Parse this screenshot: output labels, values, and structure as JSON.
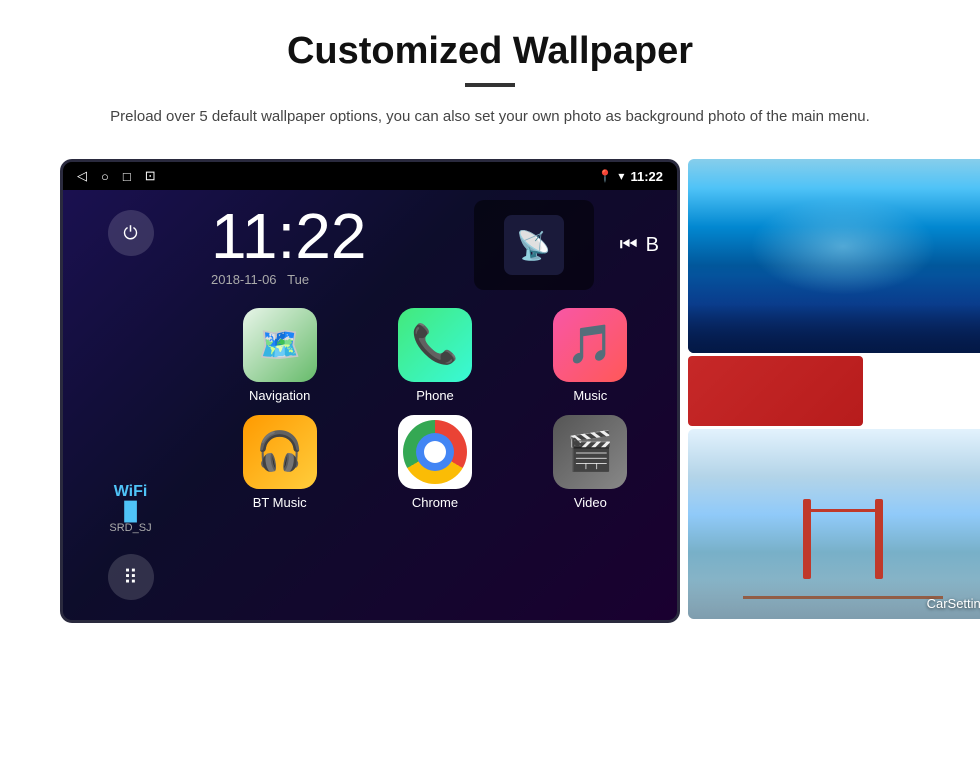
{
  "page": {
    "title": "Customized Wallpaper",
    "divider": "—",
    "subtitle": "Preload over 5 default wallpaper options, you can also set your own photo as background photo of the main menu."
  },
  "device": {
    "statusBar": {
      "time": "11:22",
      "icons": [
        "back",
        "home",
        "recent",
        "screenshot"
      ],
      "rightIcons": [
        "location",
        "wifi",
        "signal"
      ]
    },
    "clock": {
      "time": "11:22",
      "date": "2018-11-06",
      "day": "Tue"
    },
    "wifi": {
      "label": "WiFi",
      "ssid": "SRD_SJ"
    },
    "apps": [
      {
        "name": "Navigation",
        "icon": "nav"
      },
      {
        "name": "Phone",
        "icon": "phone"
      },
      {
        "name": "Music",
        "icon": "music"
      },
      {
        "name": "BT Music",
        "icon": "bt"
      },
      {
        "name": "Chrome",
        "icon": "chrome"
      },
      {
        "name": "Video",
        "icon": "video"
      }
    ],
    "carSetting": "CarSetting"
  }
}
